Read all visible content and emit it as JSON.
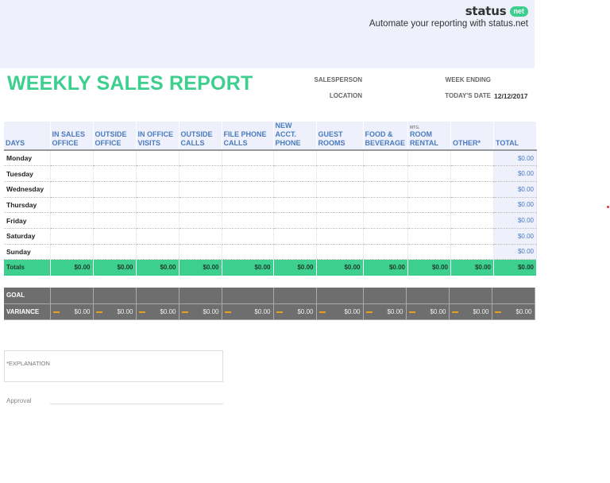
{
  "brand": {
    "name": "status",
    "badge": "net",
    "tagline": "Automate your reporting with status.net",
    "accent": "#3ccf8e"
  },
  "report": {
    "title": "WEEKLY SALES REPORT",
    "salesperson_label": "SALESPERSON",
    "location_label": "LOCATION",
    "week_ending_label": "WEEK ENDING",
    "todays_date_label": "TODAY'S DATE",
    "todays_date_value": "12/12/2017"
  },
  "table": {
    "columns": [
      {
        "line1": "",
        "line2": "DAYS"
      },
      {
        "line1": "IN SALES",
        "line2": "OFFICE"
      },
      {
        "line1": "OUTSIDE",
        "line2": "OFFICE"
      },
      {
        "line1": "IN OFFICE",
        "line2": "VISITS"
      },
      {
        "line1": "OUTSIDE",
        "line2": "CALLS"
      },
      {
        "line1": "FILE PHONE",
        "line2": "CALLS"
      },
      {
        "line1": "NEW ACCT.",
        "line2": "PHONE"
      },
      {
        "line1": "GUEST",
        "line2": "ROOMS"
      },
      {
        "line1": "FOOD &",
        "line2": "BEVERAGE"
      },
      {
        "line0": "MTG.",
        "line1": "ROOM",
        "line2": "RENTAL"
      },
      {
        "line1": "",
        "line2": "OTHER*"
      },
      {
        "line1": "",
        "line2": "TOTAL"
      }
    ],
    "rows": [
      {
        "day": "Monday",
        "total": "$0.00"
      },
      {
        "day": "Tuesday",
        "total": "$0.00"
      },
      {
        "day": "Wednesday",
        "total": "$0.00"
      },
      {
        "day": "Thursday",
        "total": "$0.00"
      },
      {
        "day": "Friday",
        "total": "$0.00"
      },
      {
        "day": "Saturday",
        "total": "$0.00"
      },
      {
        "day": "Sunday",
        "total": "$0.00"
      }
    ],
    "totals": {
      "label": "Totals",
      "values": [
        "$0.00",
        "$0.00",
        "$0.00",
        "$0.00",
        "$0.00",
        "$0.00",
        "$0.00",
        "$0.00",
        "$0.00",
        "$0.00",
        "$0.00"
      ]
    }
  },
  "goal": {
    "goal_label": "GOAL",
    "variance_label": "VARIANCE",
    "variance_values": [
      "$0.00",
      "$0.00",
      "$0.00",
      "$0.00",
      "$0.00",
      "$0.00",
      "$0.00",
      "$0.00",
      "$0.00",
      "$0.00",
      "$0.00"
    ]
  },
  "footer": {
    "explanation_label": "*EXPLANATION",
    "approval_label": "Approval"
  }
}
